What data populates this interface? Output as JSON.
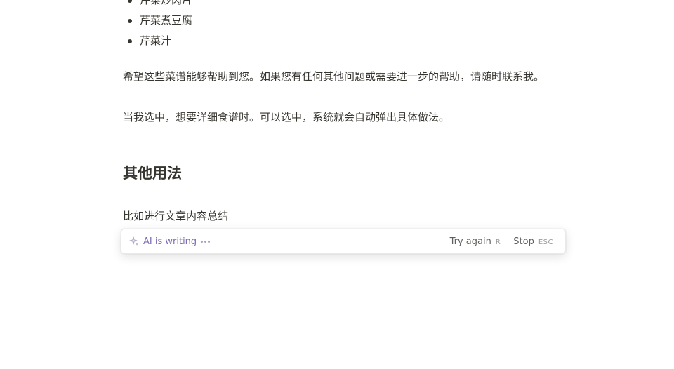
{
  "content": {
    "list_items": [
      "芹菜炒肉片",
      "芹菜煮豆腐",
      "芹菜汁"
    ],
    "paragraph_1": "希望这些菜谱能够帮助到您。如果您有任何其他问题或需要进一步的帮助，请随时联系我。",
    "paragraph_2": "当我选中，想要详细食谱时。可以选中，系统就会自动弹出具体做法。",
    "heading": "其他用法",
    "paragraph_3": "比如进行文章内容总结"
  },
  "ai_bar": {
    "status": "AI is writing",
    "try_again_label": "Try again",
    "try_again_shortcut": "R",
    "stop_label": "Stop",
    "stop_shortcut": "ESC",
    "accent_color": "#7e6cb6"
  }
}
